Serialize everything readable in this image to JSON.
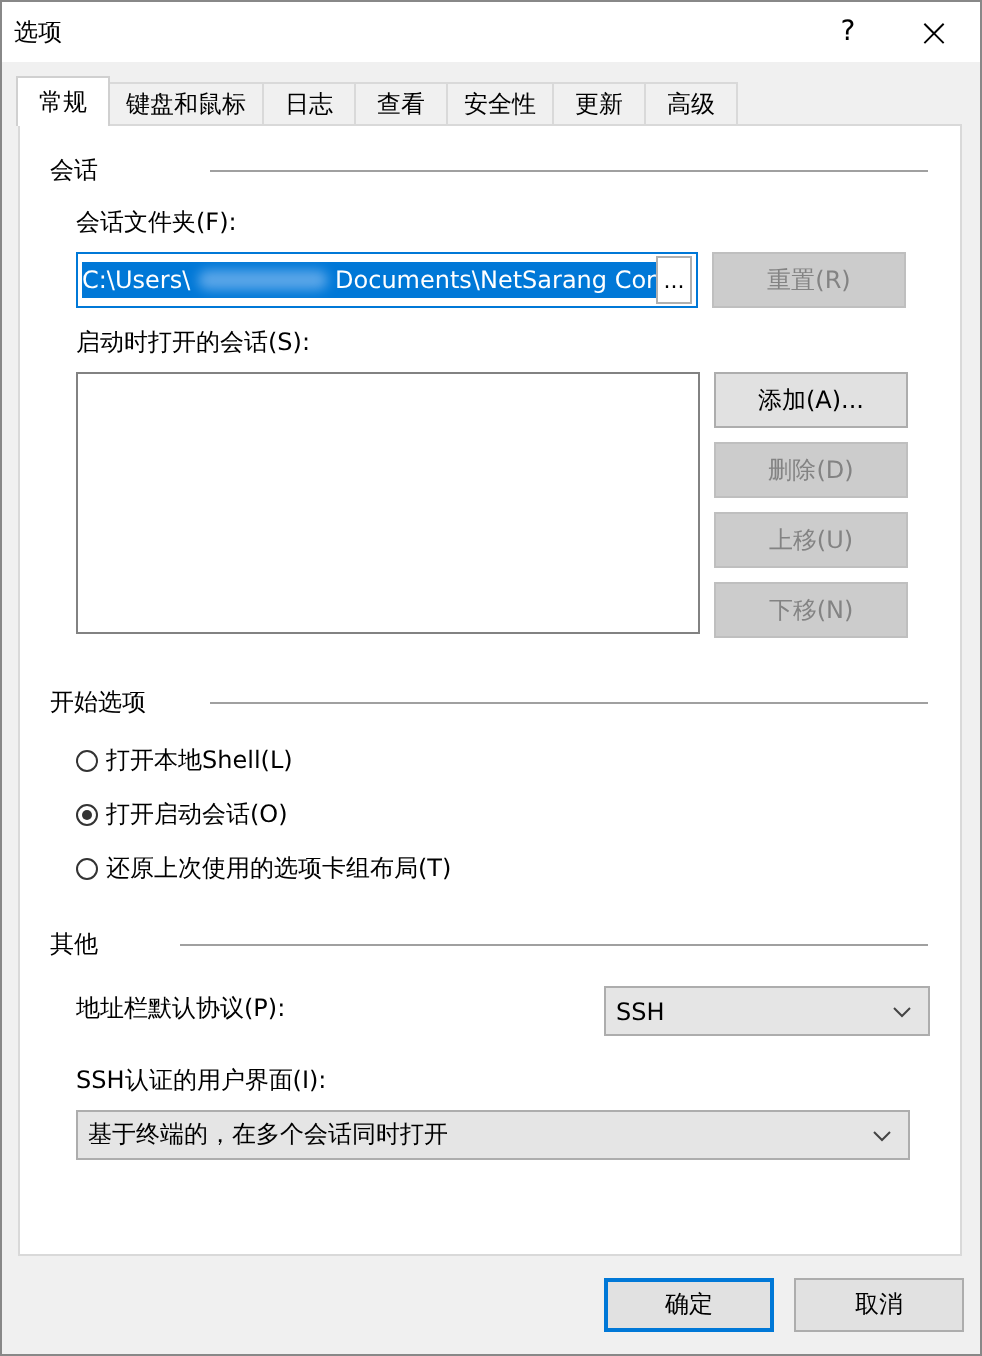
{
  "window": {
    "title": "选项",
    "help": "?",
    "close": "×"
  },
  "tabs": [
    {
      "label": "常规",
      "selected": true
    },
    {
      "label": "键盘和鼠标",
      "selected": false
    },
    {
      "label": "日志",
      "selected": false
    },
    {
      "label": "查看",
      "selected": false
    },
    {
      "label": "安全性",
      "selected": false
    },
    {
      "label": "更新",
      "selected": false
    },
    {
      "label": "高级",
      "selected": false
    }
  ],
  "session": {
    "heading": "会话",
    "folder_label": "会话文件夹(F):",
    "folder_value_start": "C:\\Users\\",
    "folder_value_end": "Documents\\NetSarang Cor",
    "folder_selected": true,
    "browse": "...",
    "reset": {
      "label": "重置(R)",
      "disabled": true
    },
    "startup_label": "启动时打开的会话(S):",
    "buttons": [
      {
        "label": "添加(A)...",
        "disabled": false
      },
      {
        "label": "删除(D)",
        "disabled": true
      },
      {
        "label": "上移(U)",
        "disabled": true
      },
      {
        "label": "下移(N)",
        "disabled": true
      }
    ]
  },
  "start_options": {
    "heading": "开始选项",
    "radios": [
      {
        "label": "打开本地Shell(L)",
        "selected": false
      },
      {
        "label": "打开启动会话(O)",
        "selected": true
      },
      {
        "label": "还原上次使用的选项卡组布局(T)",
        "selected": false
      }
    ]
  },
  "other": {
    "heading": "其他",
    "protocol_label": "地址栏默认协议(P):",
    "protocol_value": "SSH",
    "auth_label": "SSH认证的用户界面(I):",
    "auth_value": "基于终端的，在多个会话同时打开"
  },
  "footer": [
    {
      "label": "确定",
      "focused": true
    },
    {
      "label": "取消",
      "focused": false
    }
  ]
}
